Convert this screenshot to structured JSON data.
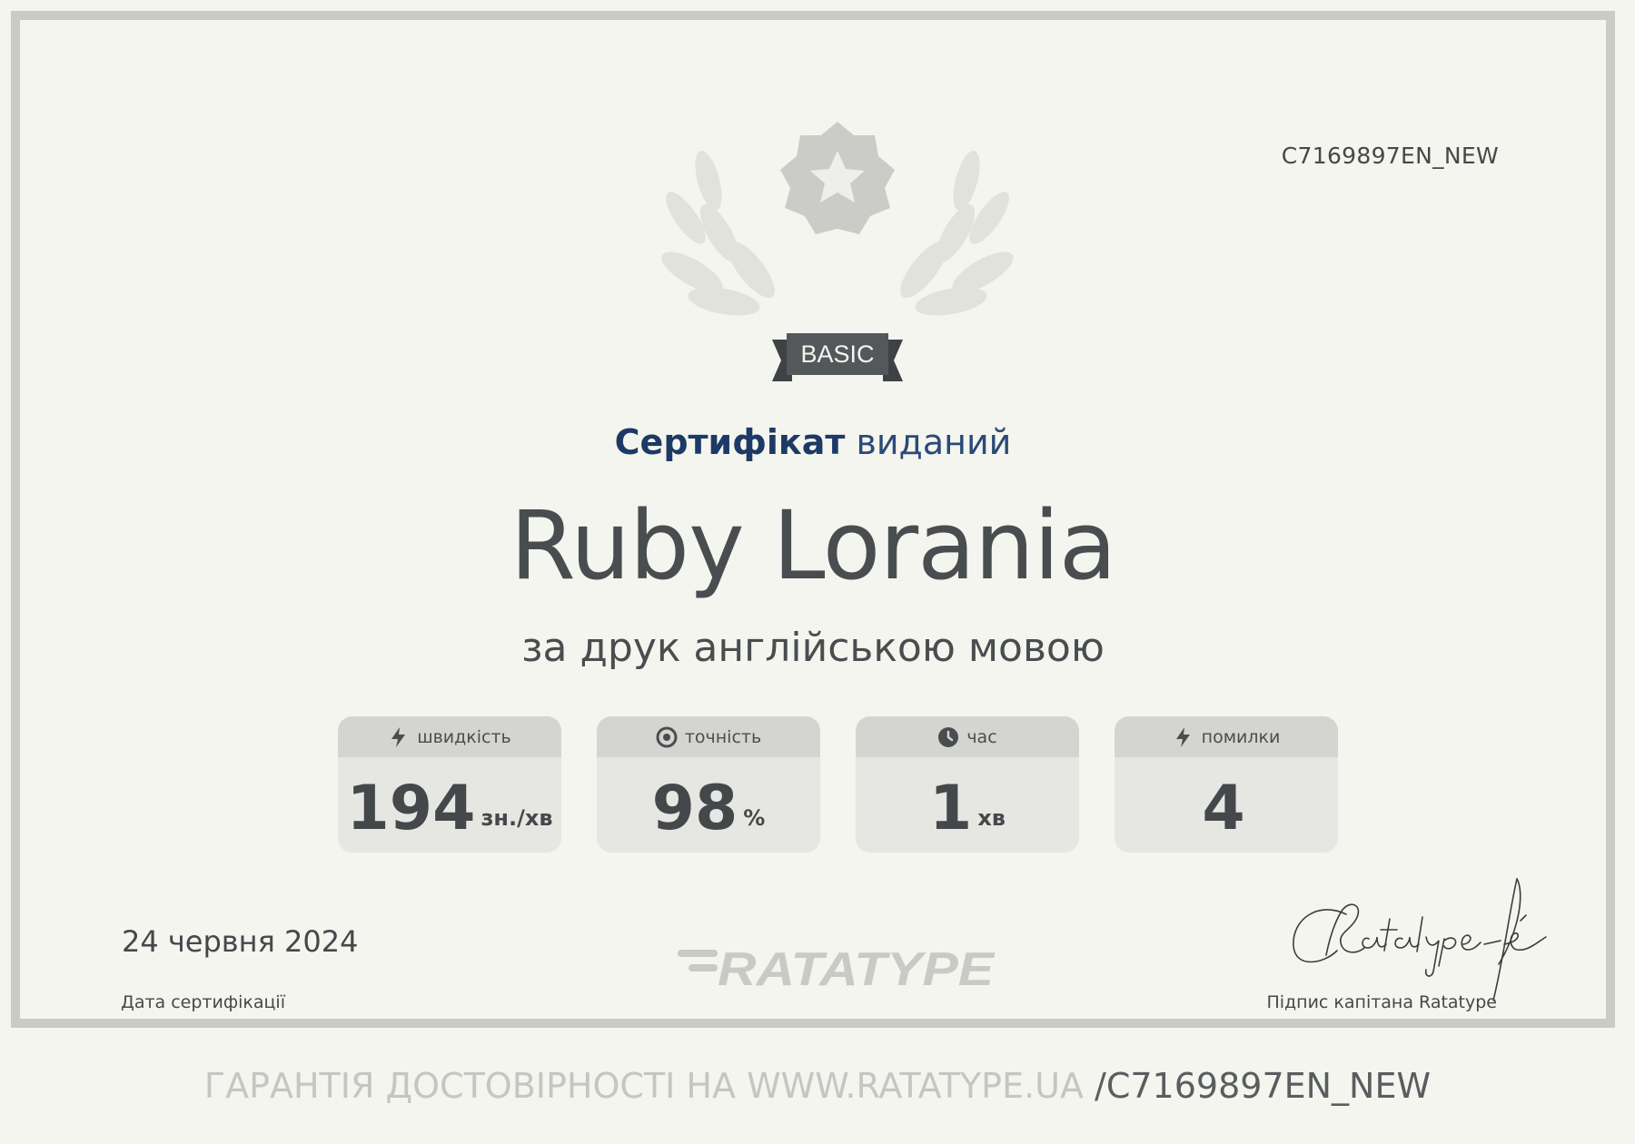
{
  "certificate": {
    "id": "C7169897EN_NEW",
    "badge_label": "BASIC",
    "issued_bold": "Сертифікат",
    "issued_light": "виданий",
    "name": "Ruby Lorania",
    "subtitle": "за друк англійською мовою"
  },
  "stats": [
    {
      "icon": "lightning-icon",
      "label": "швидкість",
      "value": "194",
      "unit": "зн./хв"
    },
    {
      "icon": "target-icon",
      "label": "точність",
      "value": "98",
      "unit": "%"
    },
    {
      "icon": "clock-icon",
      "label": "час",
      "value": "1",
      "unit": "хв"
    },
    {
      "icon": "lightning-icon",
      "label": "помилки",
      "value": "4",
      "unit": ""
    }
  ],
  "footer_info": {
    "date": "24 червня 2024",
    "date_label": "Дата сертифікації",
    "logo_text": "RATATYPE",
    "signature_label": "Підпис капітана Ratatype"
  },
  "verify": {
    "prefix": "ГАРАНТІЯ ДОСТОВІРНОСТІ НА WWW.RATATYPE.UA ",
    "path": "/C7169897EN_NEW"
  },
  "colors": {
    "background": "#f4f5ee",
    "frame": "#c9cbc5",
    "issued_text": "#1d3a66",
    "main_text": "#4a4d50"
  }
}
